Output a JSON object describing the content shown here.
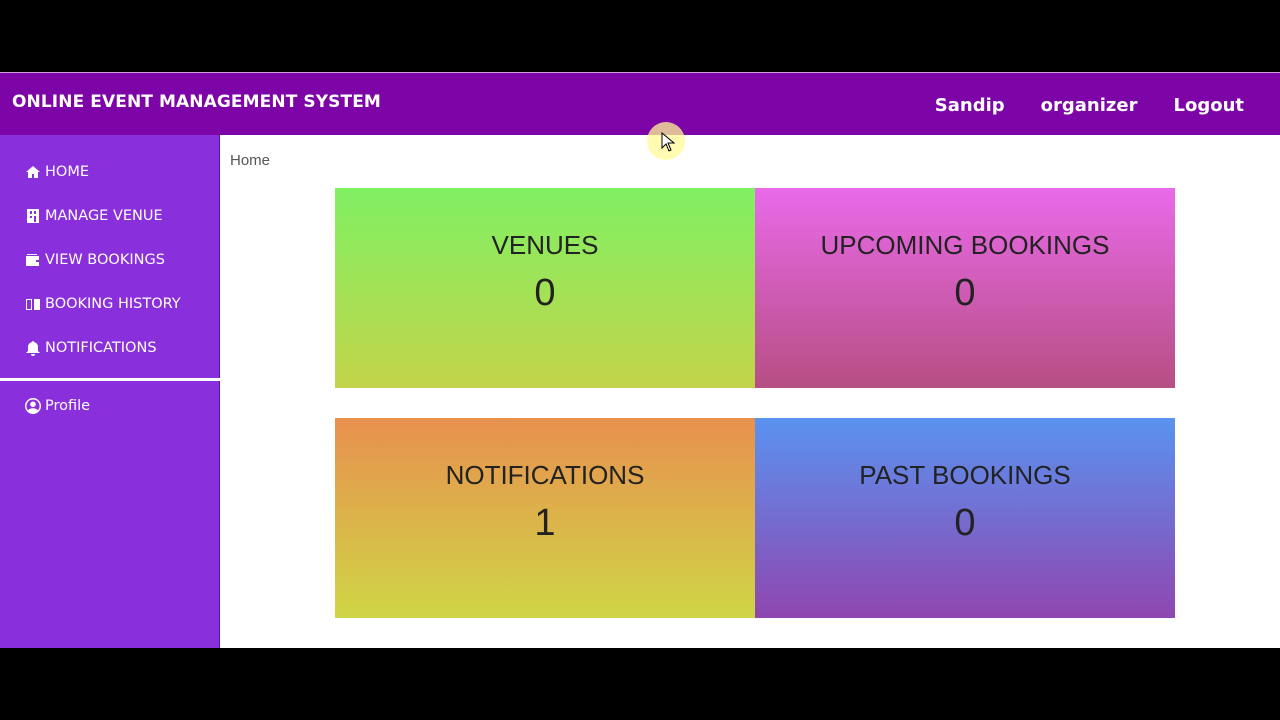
{
  "navbar": {
    "brand": "ONLINE EVENT MANAGEMENT SYSTEM",
    "links": [
      "Sandip",
      "organizer",
      "Logout"
    ]
  },
  "sidebar": {
    "items": [
      {
        "label": "HOME",
        "icon": "home-icon"
      },
      {
        "label": "MANAGE VENUE",
        "icon": "building-icon"
      },
      {
        "label": "VIEW BOOKINGS",
        "icon": "wallet-icon"
      },
      {
        "label": "BOOKING HISTORY",
        "icon": "book-icon"
      },
      {
        "label": "NOTIFICATIONS",
        "icon": "bell-icon"
      }
    ],
    "profile": {
      "label": "Profile",
      "icon": "user-circle-icon"
    }
  },
  "breadcrumb": "Home",
  "cards": [
    {
      "label": "VENUES",
      "value": "0"
    },
    {
      "label": "UPCOMING BOOKINGS",
      "value": "0"
    },
    {
      "label": "NOTIFICATIONS",
      "value": "1"
    },
    {
      "label": "PAST BOOKINGS",
      "value": "0"
    }
  ],
  "colors": {
    "navbar": "#7d04a6",
    "sidebar": "#8a2fdc"
  }
}
